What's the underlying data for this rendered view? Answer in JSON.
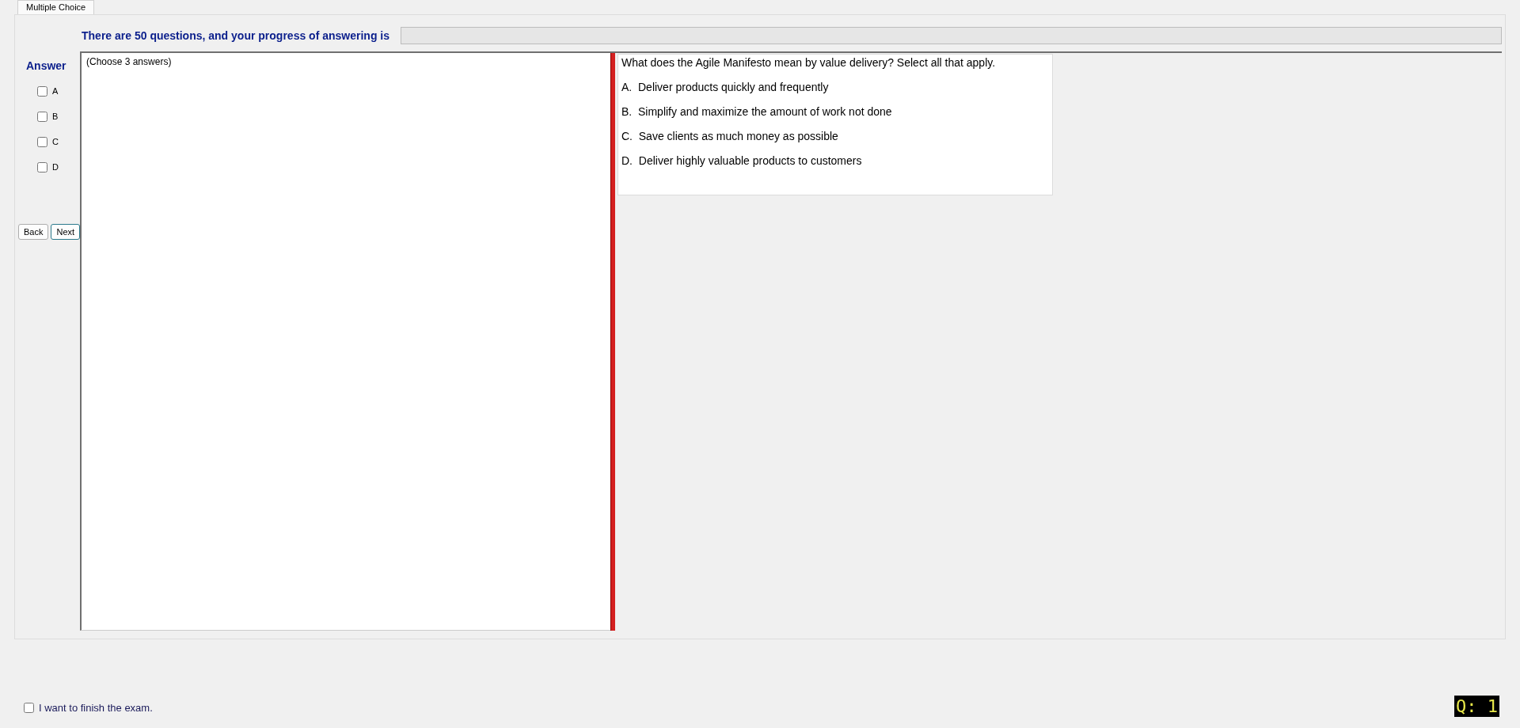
{
  "tabs": [
    {
      "label": "Multiple Choice",
      "selected": true
    }
  ],
  "header": {
    "text": "There are 50 questions, and your progress of answering is",
    "progress": {
      "level": 0
    }
  },
  "answer_panel": {
    "title": "Answer",
    "options": [
      {
        "label": "A",
        "checked": false
      },
      {
        "label": "B",
        "checked": false
      },
      {
        "label": "C",
        "checked": false
      },
      {
        "label": "D",
        "checked": false
      }
    ],
    "buttons": [
      "Back",
      "Next"
    ]
  },
  "left_pane": {
    "text": "(Choose 3 answers)"
  },
  "question": {
    "text": "What does the Agile Manifesto mean by value delivery? Select all that apply.",
    "choices": [
      "A.  Deliver products quickly and frequently",
      "B.  Simplify and maximize the amount of work not done",
      "C.  Save clients as much money as possible",
      "D.  Deliver highly valuable products to customers"
    ]
  },
  "finish": {
    "label": "I want to finish the exam.",
    "checked": false
  },
  "counter": "Q: 1"
}
